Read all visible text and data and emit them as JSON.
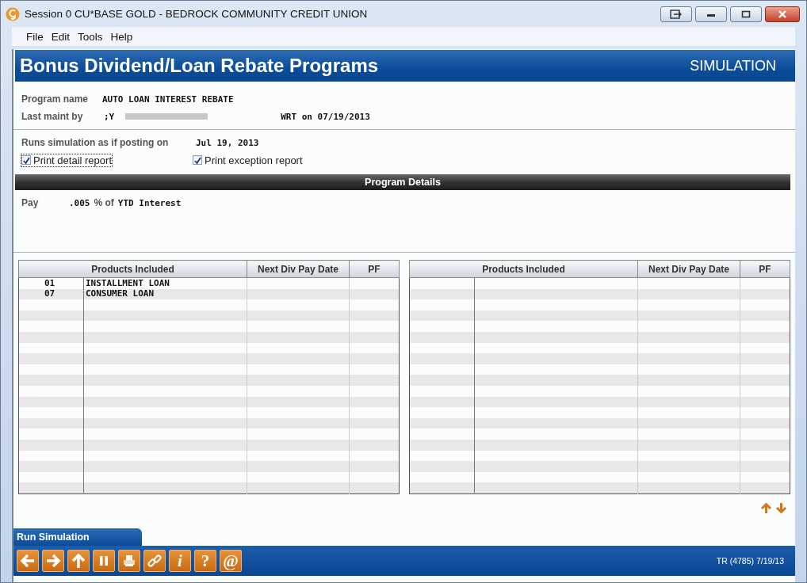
{
  "window": {
    "title": "Session 0 CU*BASE GOLD - BEDROCK COMMUNITY CREDIT UNION"
  },
  "menu": [
    "File",
    "Edit",
    "Tools",
    "Help"
  ],
  "header": {
    "title": "Bonus Dividend/Loan Rebate Programs",
    "mode": "SIMULATION"
  },
  "program": {
    "name_label": "Program name",
    "name": "AUTO LOAN INTEREST REBATE",
    "maint_label": "Last maint by",
    "maint_by": ";Y",
    "maint_on": "WRT on 07/19/2013"
  },
  "simulation": {
    "label": "Runs simulation as if posting on",
    "date": "Jul 19, 2013"
  },
  "options": [
    {
      "label": "Print detail report",
      "checked": true,
      "focused": true
    },
    {
      "label": "Print exception report",
      "checked": true,
      "focused": false
    }
  ],
  "details": {
    "title": "Program Details",
    "pay_label": "Pay",
    "rate": ".005",
    "of_label": "% of",
    "basis": "YTD Interest"
  },
  "tables": [
    {
      "columns": [
        "Products Included",
        "Next Div Pay Date",
        "PF"
      ],
      "rows": [
        {
          "code": "01",
          "description": "INSTALLMENT LOAN"
        },
        {
          "code": "07",
          "description": "CONSUMER LOAN"
        }
      ]
    },
    {
      "columns": [
        "Products Included",
        "Next Div Pay Date",
        "PF"
      ]
    }
  ],
  "action_tab": "Run Simulation",
  "toolbar": [
    {
      "kind": "back"
    },
    {
      "kind": "forward"
    },
    {
      "kind": "up"
    },
    {
      "kind": "pause"
    },
    {
      "kind": "print"
    },
    {
      "kind": "link"
    },
    {
      "kind": "glyph",
      "glyph": "i",
      "italic": true
    },
    {
      "kind": "glyph",
      "glyph": "?",
      "italic": false
    },
    {
      "kind": "glyph",
      "glyph": "@",
      "italic": false
    }
  ],
  "status": "TR (4785) 7/19/13"
}
